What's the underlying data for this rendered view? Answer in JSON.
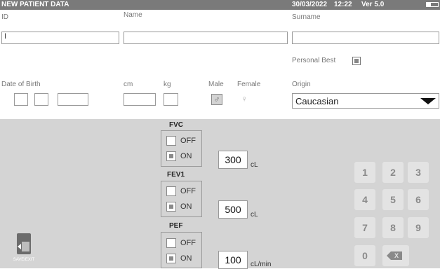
{
  "header": {
    "title": "NEW PATIENT DATA",
    "date": "30/03/2022",
    "time": "12:22",
    "version": "Ver 5.0",
    "battery": "battery-icon"
  },
  "form": {
    "id_label": "ID",
    "id_value": "I",
    "name_label": "Name",
    "surname_label": "Surname",
    "personal_best_label": "Personal Best",
    "dob_label": "Date of Birth",
    "cm_label": "cm",
    "kg_label": "kg",
    "male_label": "Male",
    "female_label": "Female",
    "male_icon": "♂",
    "female_icon": "♀",
    "origin_label": "Origin",
    "origin_value": "Caucasian"
  },
  "tests": [
    {
      "title": "FVC",
      "off": "OFF",
      "on": "ON",
      "value": "300",
      "unit": "cL"
    },
    {
      "title": "FEV1",
      "off": "OFF",
      "on": "ON",
      "value": "500",
      "unit": "cL"
    },
    {
      "title": "PEF",
      "off": "OFF",
      "on": "ON",
      "value": "100",
      "unit": "cL/min"
    }
  ],
  "keypad": [
    "1",
    "2",
    "3",
    "4",
    "5",
    "6",
    "7",
    "8",
    "9",
    "0"
  ],
  "keypad_backspace": "X",
  "save_exit": "SAVE/EXIT"
}
